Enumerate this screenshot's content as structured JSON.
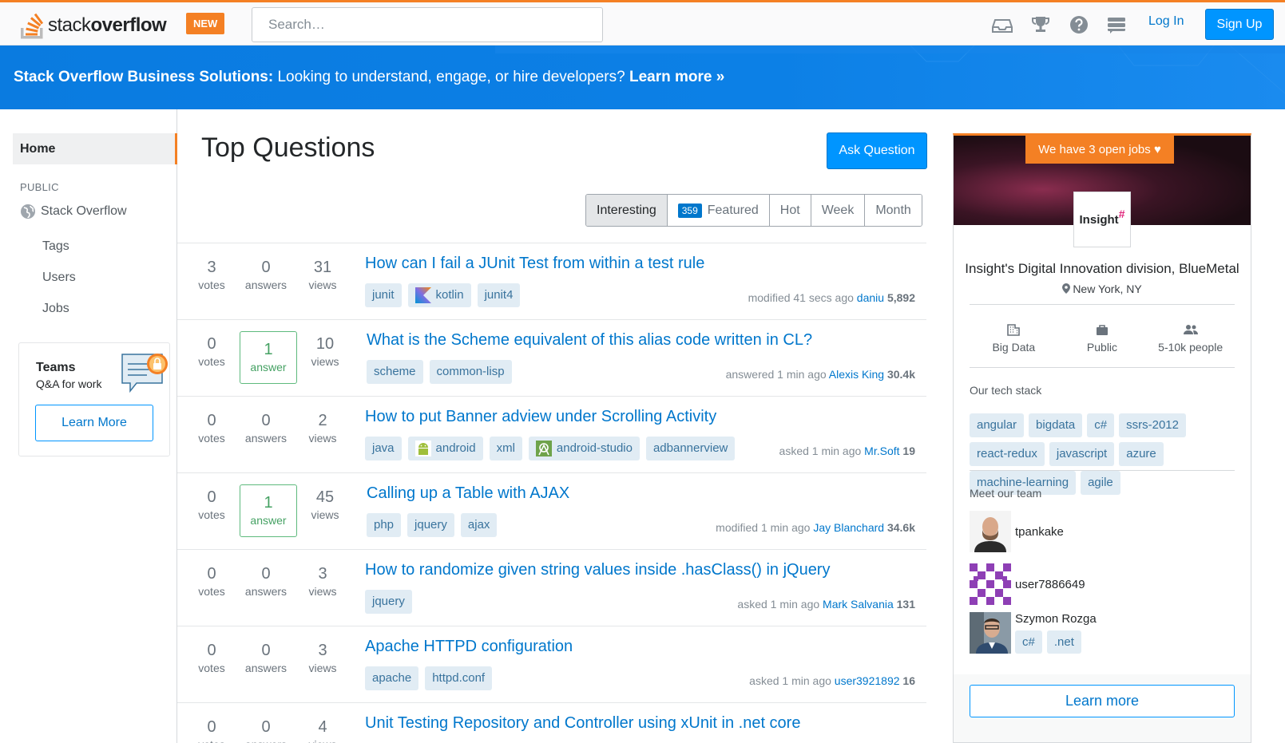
{
  "header": {
    "logo_light": "stack",
    "logo_bold": "overflow",
    "new_badge": "NEW",
    "search_placeholder": "Search…",
    "login": "Log In",
    "signup": "Sign Up"
  },
  "banner": {
    "bold": "Stack Overflow Business Solutions:",
    "text": " Looking to understand, engage, or hire developers? ",
    "link": "Learn more »"
  },
  "nav": {
    "home": "Home",
    "public": "PUBLIC",
    "stackoverflow": "Stack Overflow",
    "tags": "Tags",
    "users": "Users",
    "jobs": "Jobs",
    "teams_title": "Teams",
    "teams_sub": "Q&A for work",
    "teams_btn": "Learn More"
  },
  "main": {
    "title": "Top Questions",
    "ask_button": "Ask Question",
    "tabs": [
      {
        "label": "Interesting"
      },
      {
        "label": "Featured",
        "badge": "359"
      },
      {
        "label": "Hot"
      },
      {
        "label": "Week"
      },
      {
        "label": "Month"
      }
    ]
  },
  "questions": [
    {
      "votes": "3",
      "votes_lbl": "votes",
      "answers": "0",
      "answers_lbl": "answers",
      "answered": false,
      "views": "31",
      "views_lbl": "views",
      "title": "How can I fail a JUnit Test from within a test rule",
      "tags": [
        {
          "name": "junit"
        },
        {
          "name": "kotlin",
          "icon": "kotlin"
        },
        {
          "name": "junit4"
        }
      ],
      "action": "modified 41 secs ago",
      "user": "daniu",
      "rep": "5,892"
    },
    {
      "votes": "0",
      "votes_lbl": "votes",
      "answers": "1",
      "answers_lbl": "answer",
      "answered": true,
      "views": "10",
      "views_lbl": "views",
      "title": "What is the Scheme equivalent of this alias code written in CL?",
      "tags": [
        {
          "name": "scheme"
        },
        {
          "name": "common-lisp"
        }
      ],
      "action": "answered 1 min ago",
      "user": "Alexis King",
      "rep": "30.4k"
    },
    {
      "votes": "0",
      "votes_lbl": "votes",
      "answers": "0",
      "answers_lbl": "answers",
      "answered": false,
      "views": "2",
      "views_lbl": "views",
      "title": "How to put Banner adview under Scrolling Activity",
      "tags": [
        {
          "name": "java"
        },
        {
          "name": "android",
          "icon": "android"
        },
        {
          "name": "xml"
        },
        {
          "name": "android-studio",
          "icon": "android-studio"
        },
        {
          "name": "adbannerview"
        }
      ],
      "action": "asked 1 min ago",
      "user": "Mr.Soft",
      "rep": "19"
    },
    {
      "votes": "0",
      "votes_lbl": "votes",
      "answers": "1",
      "answers_lbl": "answer",
      "answered": true,
      "views": "45",
      "views_lbl": "views",
      "title": "Calling up a Table with AJAX",
      "tags": [
        {
          "name": "php"
        },
        {
          "name": "jquery"
        },
        {
          "name": "ajax"
        }
      ],
      "action": "modified 1 min ago",
      "user": "Jay Blanchard",
      "rep": "34.6k"
    },
    {
      "votes": "0",
      "votes_lbl": "votes",
      "answers": "0",
      "answers_lbl": "answers",
      "answered": false,
      "views": "3",
      "views_lbl": "views",
      "title": "How to randomize given string values inside .hasClass() in jQuery",
      "tags": [
        {
          "name": "jquery"
        }
      ],
      "action": "asked 1 min ago",
      "user": "Mark Salvania",
      "rep": "131"
    },
    {
      "votes": "0",
      "votes_lbl": "votes",
      "answers": "0",
      "answers_lbl": "answers",
      "answered": false,
      "views": "3",
      "views_lbl": "views",
      "title": "Apache HTTPD configuration",
      "tags": [
        {
          "name": "apache"
        },
        {
          "name": "httpd.conf"
        }
      ],
      "action": "asked 1 min ago",
      "user": "user3921892",
      "rep": "16"
    },
    {
      "votes": "0",
      "votes_lbl": "votes",
      "answers": "0",
      "answers_lbl": "answers",
      "answered": false,
      "views": "4",
      "views_lbl": "views",
      "title": "Unit Testing Repository and Controller using xUnit in .net core",
      "tags": [],
      "action": "",
      "user": "",
      "rep": ""
    }
  ],
  "jobs": {
    "pill": "We have 3 open jobs ♥",
    "logo_text": "Insight",
    "logo_mark": "#",
    "company": "Insight's Digital Innovation division, BlueMetal",
    "location": "New York, NY",
    "facts": [
      {
        "icon": "building-icon",
        "label": "Big Data"
      },
      {
        "icon": "briefcase-icon",
        "label": "Public"
      },
      {
        "icon": "people-icon",
        "label": "5-10k people"
      }
    ],
    "stack_title": "Our tech stack",
    "stack": [
      "angular",
      "bigdata",
      "c#",
      "ssrs-2012",
      "react-redux",
      "javascript",
      "azure",
      "machine-learning",
      "agile"
    ],
    "team_title": "Meet our team",
    "team": [
      {
        "name": "tpankake",
        "tags": []
      },
      {
        "name": "user7886649",
        "tags": []
      },
      {
        "name": "Szymon Rozga",
        "tags": [
          "c#",
          ".net"
        ]
      }
    ],
    "learn_more": "Learn more"
  },
  "colors": {
    "accent": "#f48024",
    "link": "#0077cc",
    "primary_button": "#0095ff",
    "banner": "#0a7be0",
    "tag_bg": "#e1ecf4",
    "tag_text": "#39739d",
    "answered_green": "#45a163"
  }
}
